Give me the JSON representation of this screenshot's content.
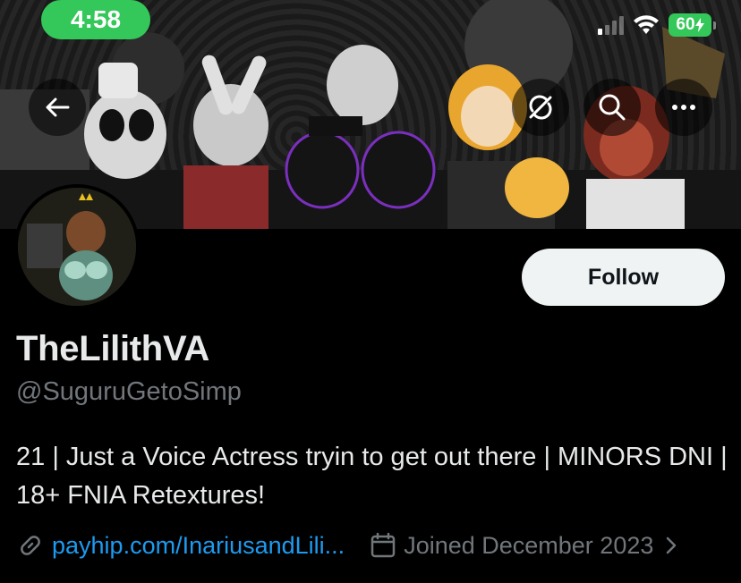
{
  "status_bar": {
    "time": "4:58",
    "battery": "60"
  },
  "profile": {
    "display_name": "TheLilithVA",
    "handle": "@SuguruGetoSimp",
    "bio": "21 | Just a Voice Actress tryin to get out there | MINORS DNI | 18+ FNIA Retextures!",
    "link": "payhip.com/InariusandLili...",
    "joined": "Joined December 2023",
    "follow_label": "Follow"
  },
  "colors": {
    "accent_link": "#1d9bf0",
    "status_green": "#34c759",
    "secondary_text": "#71767b",
    "follow_bg": "#eff3f4"
  },
  "icons": {
    "back": "back-arrow-icon",
    "sync": "sync-icon",
    "search": "search-icon",
    "more": "more-icon",
    "link": "link-icon",
    "calendar": "calendar-icon",
    "chevron": "chevron-right-icon"
  }
}
